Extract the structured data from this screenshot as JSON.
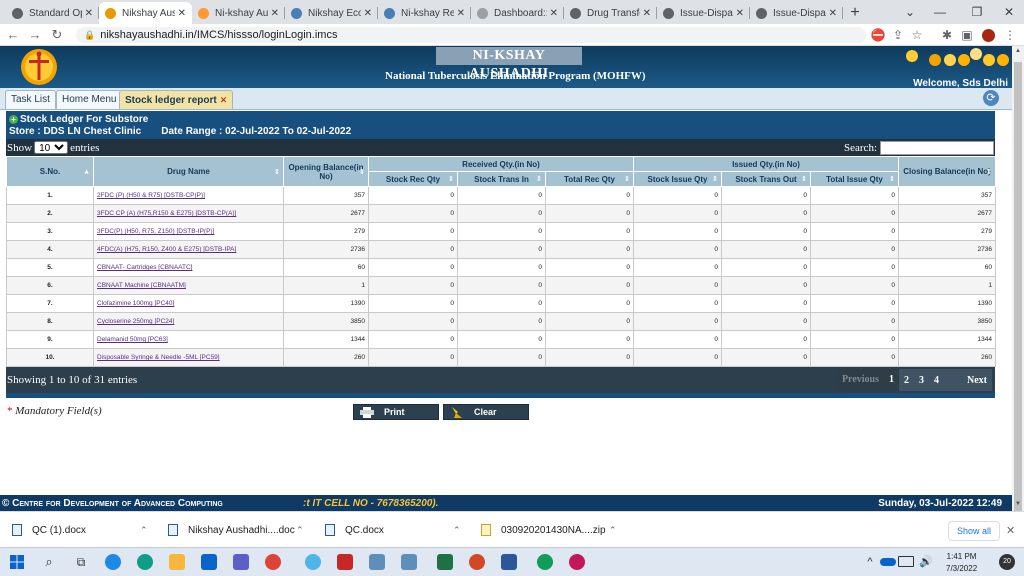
{
  "browser": {
    "tabs": [
      {
        "label": "Standard Ope",
        "fav": "#5f6368",
        "active": false
      },
      {
        "label": "Nikshay Aush",
        "fav": "#e69a00",
        "active": true
      },
      {
        "label": "Ni-kshay Aust",
        "fav": "#ff9933",
        "active": false
      },
      {
        "label": "Nikshay Ecosy",
        "fav": "#4a7fb5",
        "active": false
      },
      {
        "label": "Ni-kshay Repo",
        "fav": "#4a7fb5",
        "active": false
      },
      {
        "label": "Dashboard::Ni",
        "fav": "#9aa0a6",
        "active": false
      },
      {
        "label": "Drug Transfer",
        "fav": "#5f6368",
        "active": false
      },
      {
        "label": "Issue-Dispatch",
        "fav": "#5f6368",
        "active": false
      },
      {
        "label": "Issue-Dispatch",
        "fav": "#5f6368",
        "active": false
      }
    ],
    "url": "nikshayaushadhi.in/IMCS/hissso/loginLogin.imcs"
  },
  "header": {
    "brand": "NI-KSHAY AUSHADHI",
    "program": "National Tuberculosis Elimination Program (MOHFW)",
    "welcome": "Welcome, Sds Delhi"
  },
  "app_tabs": [
    {
      "label": "Task List"
    },
    {
      "label": "Home Menu"
    },
    {
      "label": "Stock ledger report"
    }
  ],
  "panel": {
    "title": "Stock Ledger For Substore",
    "store": "Store : DDS LN Chest Clinic",
    "date_range": "Date Range : 02-Jul-2022 To 02-Jul-2022",
    "show_label": "Show",
    "entries_value": "10",
    "entries_label": "entries",
    "search_label": "Search:"
  },
  "table": {
    "headers": {
      "sno": "S.No.",
      "drug": "Drug Name",
      "opening": "Opening Balance(in No)",
      "received": "Received Qty.(in No)",
      "issued": "Issued Qty.(in No)",
      "closing": "Closing Balance(in No)",
      "stock_rec": "Stock Rec Qty",
      "stock_trans_in": "Stock Trans In",
      "total_rec": "Total Rec Qty",
      "stock_issue": "Stock Issue Qty",
      "stock_trans_out": "Stock Trans Out",
      "total_issue": "Total Issue Qty"
    },
    "rows": [
      {
        "sno": "1.",
        "drug": "2FDC (P) (H50 & R75) [DSTB-CP(P)]",
        "opening": "357",
        "rec": "0",
        "tin": "0",
        "trec": "0",
        "iss": "0",
        "tout": "0",
        "tiss": "0",
        "closing": "357"
      },
      {
        "sno": "2.",
        "drug": "3FDC CP (A) (H75,R150 & E275) [DSTB-CP(A)]",
        "opening": "2677",
        "rec": "0",
        "tin": "0",
        "trec": "0",
        "iss": "0",
        "tout": "0",
        "tiss": "0",
        "closing": "2677"
      },
      {
        "sno": "3.",
        "drug": "3FDC(P) (H50, R75, Z150) [DSTB-IP(P)]",
        "opening": "279",
        "rec": "0",
        "tin": "0",
        "trec": "0",
        "iss": "0",
        "tout": "0",
        "tiss": "0",
        "closing": "279"
      },
      {
        "sno": "4.",
        "drug": "4FDC(A) (H75, R150, Z400 & E275) [DSTB-IPA]",
        "opening": "2736",
        "rec": "0",
        "tin": "0",
        "trec": "0",
        "iss": "0",
        "tout": "0",
        "tiss": "0",
        "closing": "2736"
      },
      {
        "sno": "5.",
        "drug": "CBNAAT- Cartridges [CBNAATC]",
        "opening": "60",
        "rec": "0",
        "tin": "0",
        "trec": "0",
        "iss": "0",
        "tout": "0",
        "tiss": "0",
        "closing": "60"
      },
      {
        "sno": "6.",
        "drug": "CBNAAT Machine [CBNAATM]",
        "opening": "1",
        "rec": "0",
        "tin": "0",
        "trec": "0",
        "iss": "0",
        "tout": "0",
        "tiss": "0",
        "closing": "1"
      },
      {
        "sno": "7.",
        "drug": "Clofazimine 100mg [PC40]",
        "opening": "1390",
        "rec": "0",
        "tin": "0",
        "trec": "0",
        "iss": "0",
        "tout": "0",
        "tiss": "0",
        "closing": "1390"
      },
      {
        "sno": "8.",
        "drug": "Cycloserine 250mg [PC24]",
        "opening": "3850",
        "rec": "0",
        "tin": "0",
        "trec": "0",
        "iss": "0",
        "tout": "0",
        "tiss": "0",
        "closing": "3850"
      },
      {
        "sno": "9.",
        "drug": "Delamanid 50mg [PC63]",
        "opening": "1344",
        "rec": "0",
        "tin": "0",
        "trec": "0",
        "iss": "0",
        "tout": "0",
        "tiss": "0",
        "closing": "1344"
      },
      {
        "sno": "10.",
        "drug": "Disposable Syringe & Needle -5ML [PC59]",
        "opening": "260",
        "rec": "0",
        "tin": "0",
        "trec": "0",
        "iss": "0",
        "tout": "0",
        "tiss": "0",
        "closing": "260"
      }
    ],
    "showing": "Showing 1 to 10 of 31 entries",
    "pagination": {
      "previous": "Previous",
      "pages": [
        "1",
        "2",
        "3",
        "4"
      ],
      "next": "Next"
    }
  },
  "form": {
    "mandatory_star": "*",
    "mandatory": "Mandatory Field(s)",
    "print": "Print",
    "clear": "Clear"
  },
  "footer": {
    "cdac": "© Centre for Development of Advanced Computing",
    "itcell": ":t IT CELL NO - 7678365200).",
    "datetime": "Sunday, 03-Jul-2022 12:49"
  },
  "downloads": [
    {
      "name": "QC (1).docx"
    },
    {
      "name": "Nikshay Aushadhi....doc"
    },
    {
      "name": "QC.docx"
    },
    {
      "name": "030920201430NA....zip"
    }
  ],
  "show_all": "Show all",
  "clock": {
    "time": "1:41 PM",
    "date": "7/3/2022",
    "badge": "20"
  },
  "colors": {
    "header": "#17507f",
    "table_header": "#a4c2d2",
    "link": "#5a2c86"
  }
}
